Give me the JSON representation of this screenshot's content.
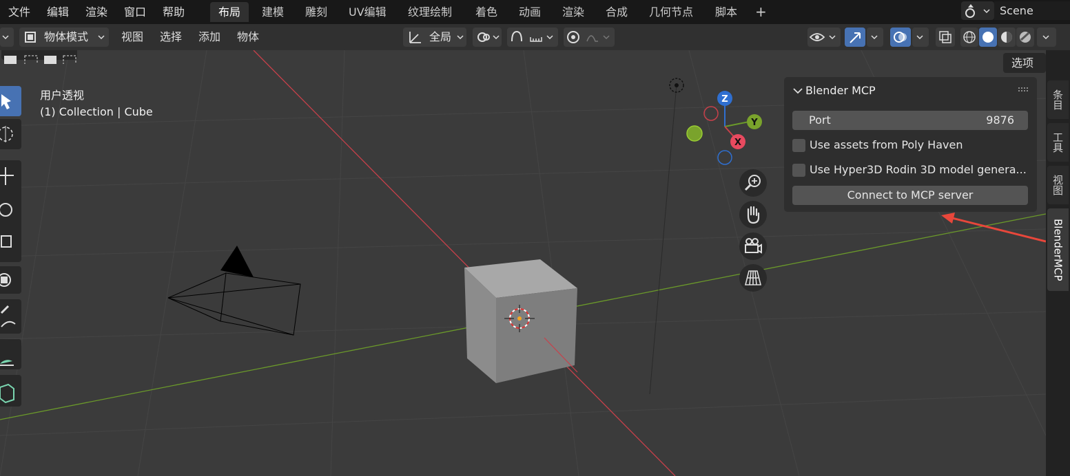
{
  "menu": [
    "文件",
    "编辑",
    "渲染",
    "窗口",
    "帮助"
  ],
  "workspaces": [
    "布局",
    "建模",
    "雕刻",
    "UV编辑",
    "纹理绘制",
    "着色",
    "动画",
    "渲染",
    "合成",
    "几何节点",
    "脚本"
  ],
  "add_tab": "+",
  "scene": "Scene",
  "header": {
    "mode": "物体模式",
    "menus": [
      "视图",
      "选择",
      "添加",
      "物体"
    ],
    "orientation": "全局",
    "options": "选项"
  },
  "viewport": {
    "view_name": "用户透视",
    "collection": "(1) Collection | Cube"
  },
  "gizmo": {
    "z": "Z",
    "y": "Y",
    "x": "X"
  },
  "panel": {
    "title": "Blender MCP",
    "port_label": "Port",
    "port_value": "9876",
    "poly_haven": "Use assets from Poly Haven",
    "hyper3d": "Use Hyper3D Rodin 3D model genera...",
    "connect": "Connect to MCP server"
  },
  "side_tabs": [
    "条目",
    "工具",
    "视图",
    "BlenderMCP"
  ],
  "colors": {
    "accent": "#4772b3",
    "arrow": "#e8473b",
    "x_axis": "#c8404a",
    "y_axis": "#6b9a2a"
  }
}
